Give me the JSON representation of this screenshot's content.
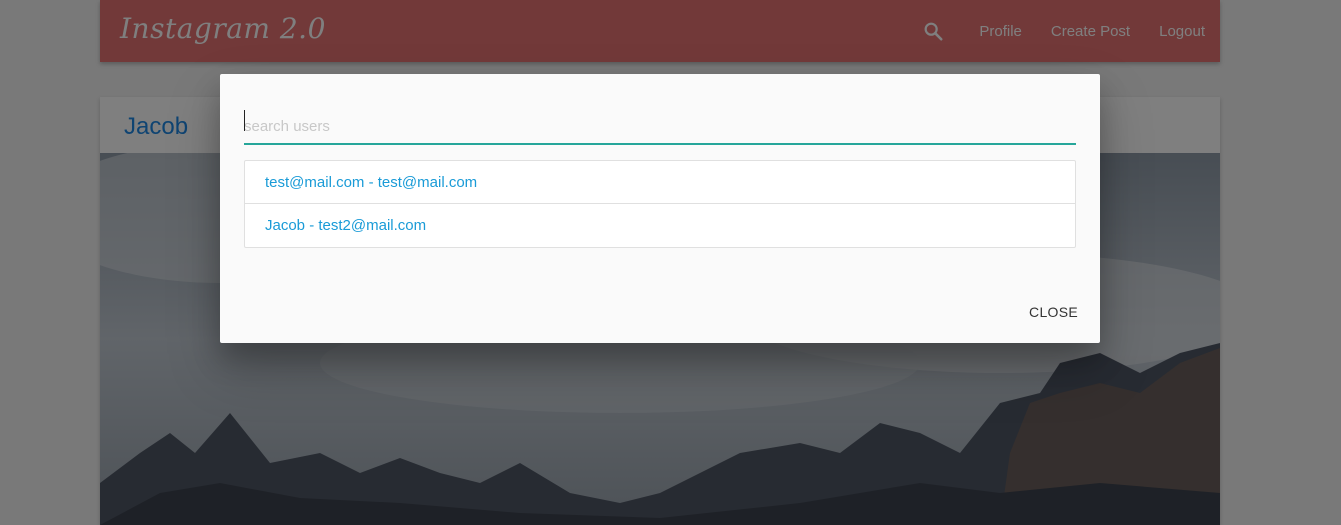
{
  "navbar": {
    "brand": "Instagram 2.0",
    "search_icon": "search-icon",
    "links": [
      "Profile",
      "Create Post",
      "Logout"
    ]
  },
  "post": {
    "author": "Jacob",
    "image": "mountain-landscape"
  },
  "modal": {
    "search": {
      "placeholder": "search users",
      "value": ""
    },
    "results": [
      "test@mail.com - test@mail.com",
      "Jacob - test2@mail.com"
    ],
    "close_label": "CLOSE"
  },
  "colors": {
    "navbar": "#e57373",
    "accent": "#26a69a",
    "link": "#1a9bd7"
  }
}
